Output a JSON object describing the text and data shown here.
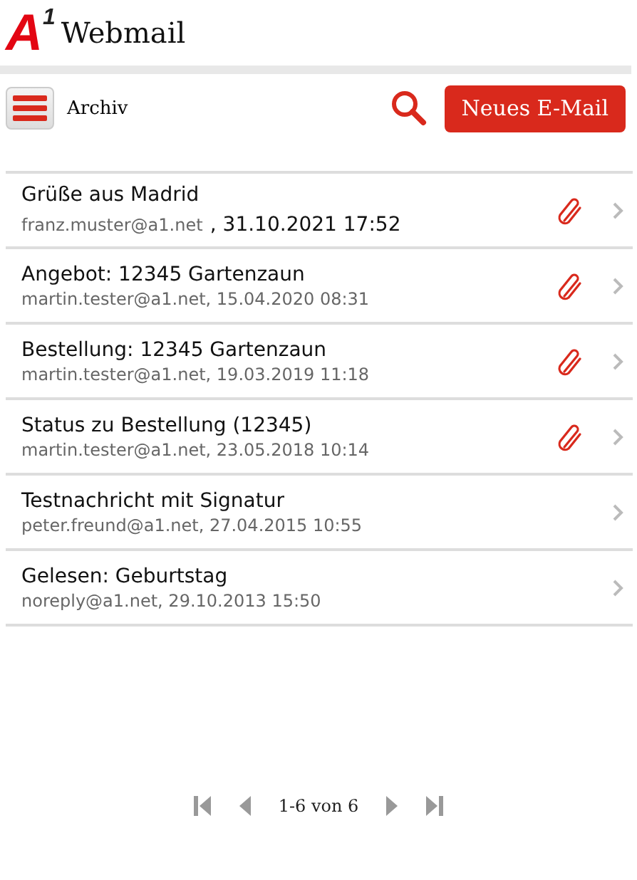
{
  "header": {
    "logo_text": "A",
    "logo_sup": "1",
    "title": "Webmail"
  },
  "toolbar": {
    "folder": "Archiv",
    "new_button": "Neues E-Mail"
  },
  "messages": [
    {
      "subject": "Grüße aus Madrid",
      "kind": "split",
      "sender": "franz.muster@a1.net",
      "date": ", 31.10.2021 17:52",
      "attachment": true
    },
    {
      "subject": "Angebot: 12345 Gartenzaun",
      "kind": "plain",
      "meta": "martin.tester@a1.net, 15.04.2020 08:31",
      "attachment": true
    },
    {
      "subject": "Bestellung: 12345 Gartenzaun",
      "kind": "plain",
      "meta": "martin.tester@a1.net, 19.03.2019 11:18",
      "attachment": true
    },
    {
      "subject": "Status zu Bestellung (12345)",
      "kind": "plain",
      "meta": "martin.tester@a1.net, 23.05.2018 10:14",
      "attachment": true
    },
    {
      "subject": "Testnachricht mit Signatur",
      "kind": "plain",
      "meta": "peter.freund@a1.net, 27.04.2015 10:55",
      "attachment": false
    },
    {
      "subject": "Gelesen: Geburtstag",
      "kind": "plain",
      "meta": "noreply@a1.net, 29.10.2013 15:50",
      "attachment": false
    }
  ],
  "pager": {
    "range": "1-6 von 6"
  }
}
